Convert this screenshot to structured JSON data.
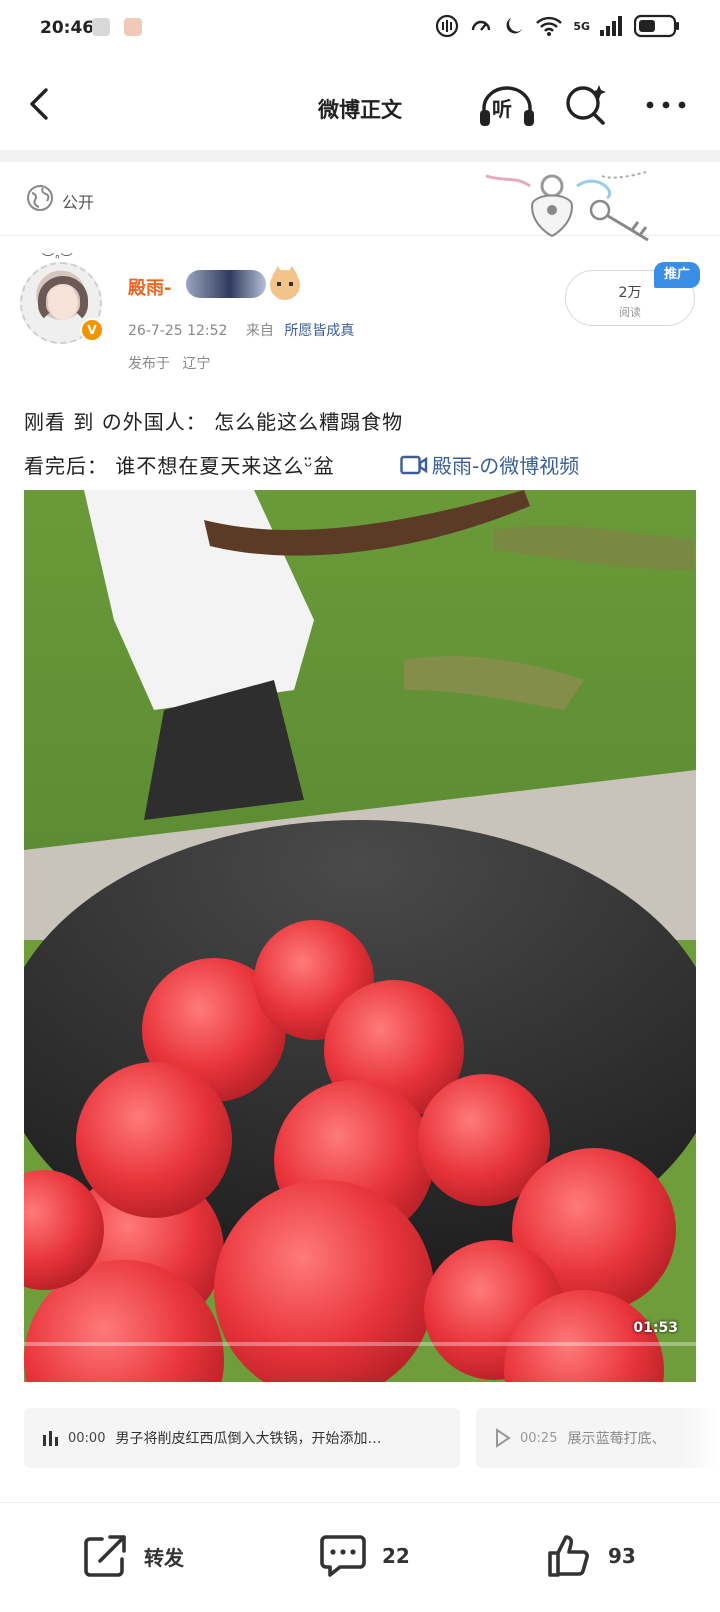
{
  "status_bar": {
    "time": "20:46",
    "network": "5G",
    "icons": [
      "notification-icon",
      "app-icon",
      "nfc-icon",
      "speed-icon",
      "moon-icon",
      "wifi-icon",
      "signal-icon",
      "battery-icon"
    ]
  },
  "header": {
    "title": "微博正文",
    "listen_label": "听"
  },
  "post": {
    "visibility": "公开",
    "author": {
      "name": "殿雨-",
      "verified_mark": "V"
    },
    "date": "26-7-25  12:52",
    "from_prefix": "来自",
    "source": "所愿皆成真",
    "location_prefix": "发布于",
    "location": "辽宁",
    "reads": {
      "count": "2万",
      "label": "阅读"
    },
    "promo_label": "推广",
    "text_line1": "刚看 到 の外国人： 怎么能这么糟蹋食物",
    "text_line2": "看完后： 谁不想在夏天来这么ᵕ̈盆",
    "video_link": "殿雨-の微博视频",
    "video": {
      "duration": "01:53"
    },
    "chapters": [
      {
        "time": "00:00",
        "text": "男子将削皮红西瓜倒入大铁锅，开始添加…"
      },
      {
        "time": "00:25",
        "text": "展示蓝莓打底、"
      }
    ]
  },
  "actions": {
    "repost_label": "转发",
    "comment_count": "22",
    "like_count": "93"
  }
}
